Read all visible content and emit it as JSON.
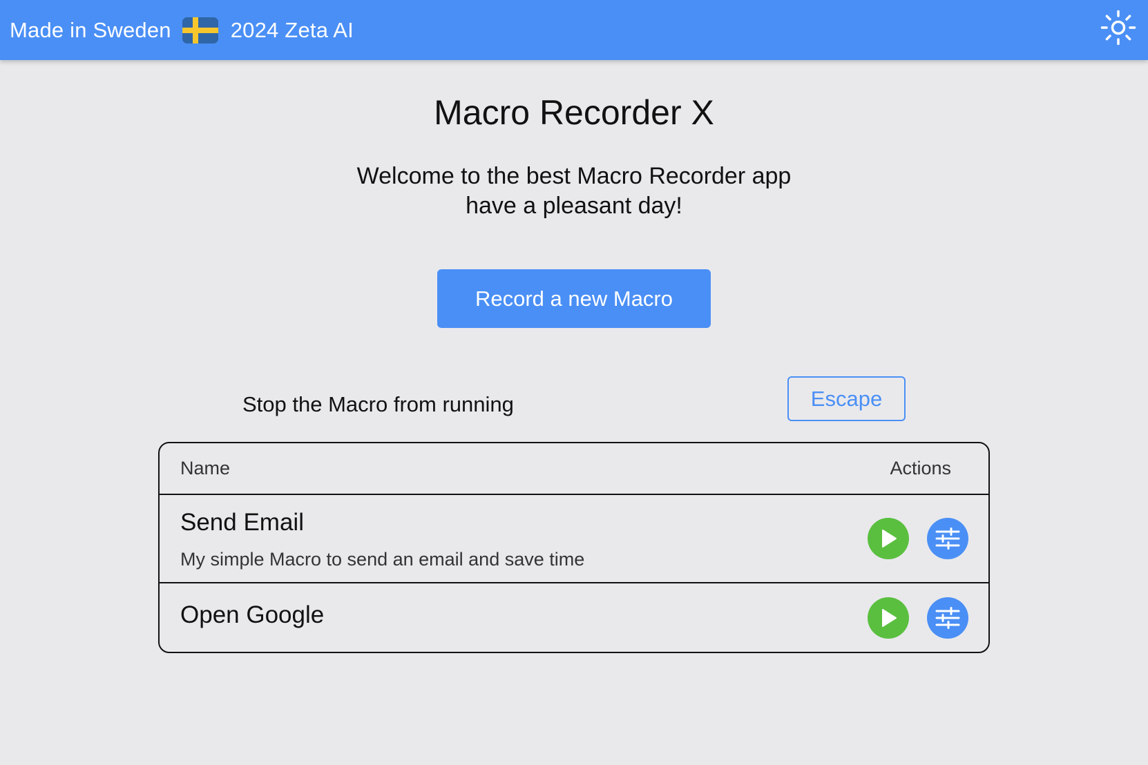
{
  "header": {
    "made_in": "Made in Sweden",
    "flag_icon": "sweden-flag-icon",
    "copyright": "2024 Zeta AI",
    "theme_icon": "sun-icon"
  },
  "colors": {
    "accent": "#4a8ff5",
    "play": "#5abf3f",
    "background": "#e9e9ec",
    "flag_blue": "#2f66a8",
    "flag_yellow": "#f6c62c"
  },
  "main": {
    "title": "Macro Recorder X",
    "welcome_line1": "Welcome to the best Macro Recorder app",
    "welcome_line2": "have a pleasant day!",
    "record_button": "Record a new Macro",
    "stop_label": "Stop the Macro from running",
    "escape_button": "Escape"
  },
  "table": {
    "columns": [
      "Name",
      "Actions"
    ],
    "rows": [
      {
        "name": "Send Email",
        "description": "My simple Macro to send an email and save time"
      },
      {
        "name": "Open Google",
        "description": ""
      }
    ]
  }
}
